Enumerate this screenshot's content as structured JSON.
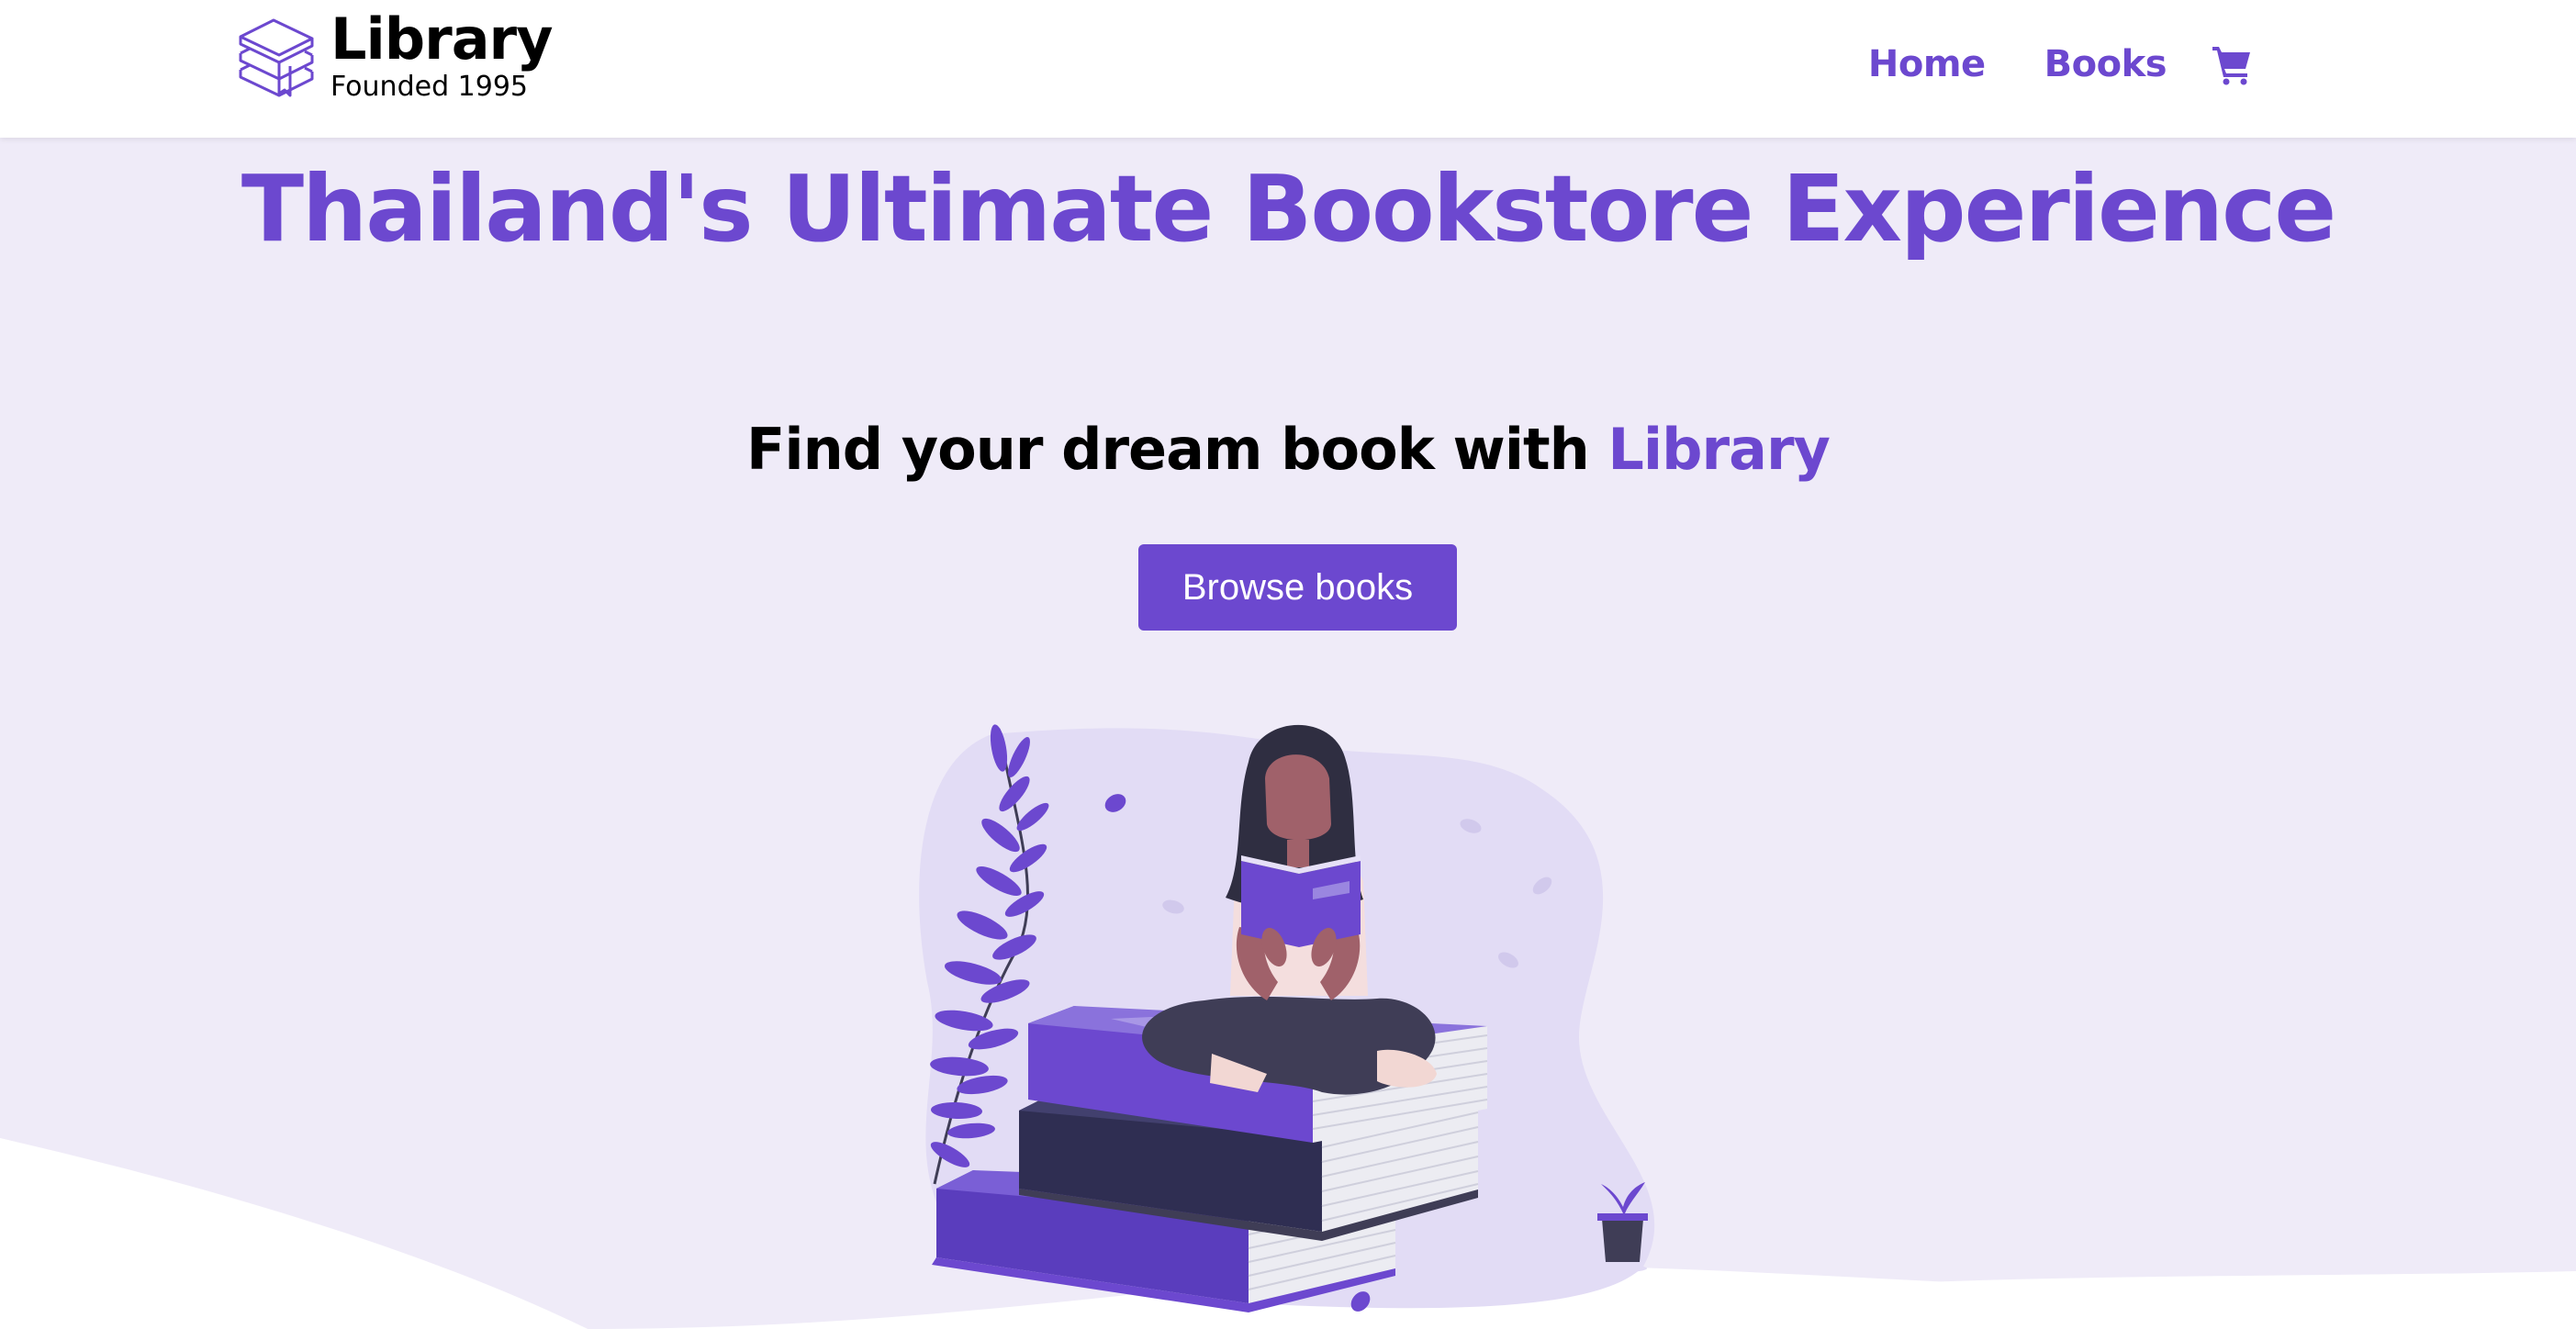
{
  "navbar": {
    "logo_title": "Library",
    "logo_subtitle": "Founded 1995",
    "links": [
      {
        "label": "Home"
      },
      {
        "label": "Books"
      }
    ],
    "cart_icon": "shopping-cart-icon"
  },
  "hero": {
    "title": "Thailand's Ultimate Bookstore Experience",
    "subtitle_prefix": "Find your dream book with ",
    "subtitle_accent": "Library",
    "cta_label": "Browse books",
    "illustration": "woman-reading-on-book-stack-illustration"
  },
  "colors": {
    "accent": "#6c48cf",
    "background": "#efebf8",
    "navbar": "#ffffff",
    "text": "#000000"
  }
}
